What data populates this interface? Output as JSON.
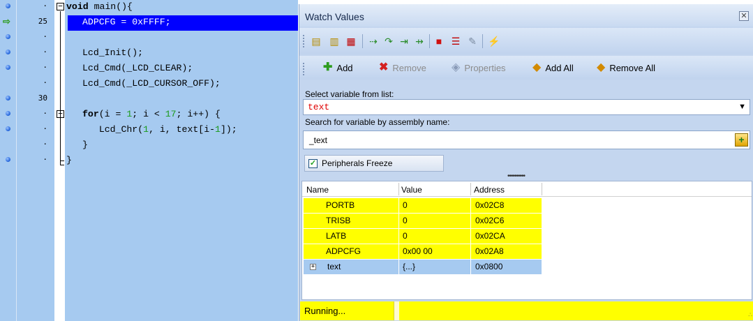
{
  "editor": {
    "lines": [
      {
        "num": "·",
        "marker": "breakpoint",
        "fold": "open",
        "parts": [
          {
            "t": "void",
            "k": "kw"
          },
          {
            "t": " main(){"
          }
        ]
      },
      {
        "num": "25",
        "marker": "exec",
        "fold": "",
        "parts": [
          {
            "t": "ADPCFG = 0xFFFF;"
          }
        ]
      },
      {
        "num": "·",
        "marker": "breakpoint",
        "fold": "",
        "parts": []
      },
      {
        "num": "·",
        "marker": "breakpoint",
        "fold": "",
        "parts": [
          {
            "t": "Lcd_Init();"
          }
        ]
      },
      {
        "num": "·",
        "marker": "breakpoint",
        "fold": "",
        "parts": [
          {
            "t": "Lcd_Cmd(_LCD_CLEAR);"
          }
        ]
      },
      {
        "num": "·",
        "marker": "",
        "fold": "",
        "parts": [
          {
            "t": "Lcd_Cmd(_LCD_CURSOR_OFF);"
          }
        ]
      },
      {
        "num": "30",
        "marker": "breakpoint",
        "fold": "",
        "parts": []
      },
      {
        "num": "·",
        "marker": "breakpoint",
        "fold": "open",
        "parts": [
          {
            "t": "for",
            "k": "kw"
          },
          {
            "t": "(i = "
          },
          {
            "t": "1",
            "k": "num"
          },
          {
            "t": "; i < "
          },
          {
            "t": "17",
            "k": "num"
          },
          {
            "t": "; i++) {"
          }
        ]
      },
      {
        "num": "·",
        "marker": "breakpoint",
        "fold": "",
        "parts": [
          {
            "t": "  Lcd_Chr("
          },
          {
            "t": "1",
            "k": "num"
          },
          {
            "t": ", i, text[i-"
          },
          {
            "t": "1",
            "k": "num"
          },
          {
            "t": "]);"
          }
        ]
      },
      {
        "num": "·",
        "marker": "",
        "fold": "",
        "parts": [
          {
            "t": "}"
          }
        ]
      },
      {
        "num": "·",
        "marker": "breakpoint",
        "fold": "",
        "parts": [
          {
            "t": "}"
          }
        ]
      }
    ]
  },
  "watch": {
    "title": "Watch Values",
    "close_icon": "close-icon",
    "toolbar2": {
      "add_label": "Add",
      "remove_label": "Remove",
      "properties_label": "Properties",
      "add_all_label": "Add All",
      "remove_all_label": "Remove All"
    },
    "select_label": "Select variable from list:",
    "selected_variable": "text",
    "search_label": "Search for variable by assembly name:",
    "search_value": "_text",
    "peripherals_freeze_label": "Peripherals Freeze",
    "peripherals_freeze_checked": true,
    "columns": {
      "name": "Name",
      "value": "Value",
      "address": "Address"
    },
    "rows": [
      {
        "name": "PORTB",
        "value": "0",
        "address": "0x02C8",
        "style": "yel",
        "expandable": false
      },
      {
        "name": "TRISB",
        "value": "0",
        "address": "0x02C6",
        "style": "yel",
        "expandable": false
      },
      {
        "name": "LATB",
        "value": "0",
        "address": "0x02CA",
        "style": "yel",
        "expandable": false
      },
      {
        "name": "ADPCFG",
        "value": "0x00 00",
        "address": "0x02A8",
        "style": "yel",
        "expandable": false
      },
      {
        "name": "text",
        "value": "{...}",
        "address": "0x0800",
        "style": "sel",
        "expandable": true
      }
    ],
    "status": "Running..."
  },
  "colors": {
    "editor_bg": "#a6caf0",
    "exec_line": "#0000ff",
    "changed_value": "#ffff00",
    "selected_row": "#a6caf0"
  }
}
